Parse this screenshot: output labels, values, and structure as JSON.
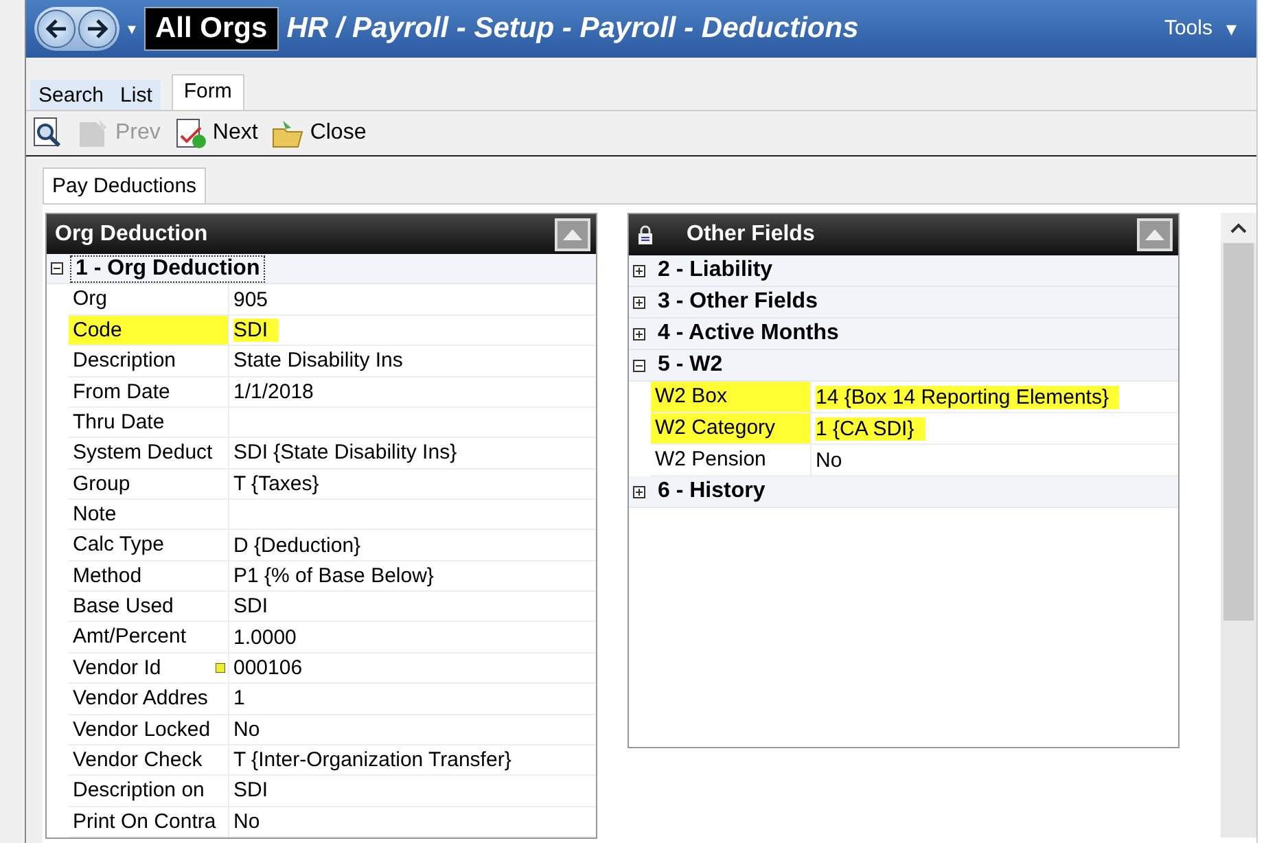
{
  "header": {
    "context": "All Orgs",
    "title": "HR / Payroll - Setup - Payroll - Deductions",
    "tools": "Tools",
    "dropdown": "▾"
  },
  "view_tabs": [
    {
      "label": "Search",
      "selected": false
    },
    {
      "label": "List",
      "selected": false
    },
    {
      "label": "Form",
      "selected": true
    }
  ],
  "toolbar": [
    {
      "kind": "find",
      "disabled": false
    },
    {
      "kind": "prev",
      "label": "Prev",
      "disabled": true
    },
    {
      "kind": "next",
      "label": "Next",
      "disabled": false
    },
    {
      "kind": "close",
      "label": "Close",
      "disabled": false
    }
  ],
  "form_tabs": [
    {
      "label": "Pay Deductions",
      "selected": true
    }
  ],
  "left_panel": {
    "title": "Org Deduction",
    "groups": [
      {
        "label": "1 - Org Deduction",
        "expanded": true,
        "fields": [
          {
            "label": "Org",
            "value": "905",
            "highlighted": false
          },
          {
            "label": "Code",
            "value": "SDI",
            "highlighted": true
          },
          {
            "label": "Description",
            "value": "State Disability Ins",
            "highlighted": false
          },
          {
            "label": "From Date",
            "value": "1/1/2018",
            "highlighted": false
          },
          {
            "label": "Thru Date",
            "highlighted": false
          },
          {
            "label": "System Deduct",
            "value": "SDI {State Disability Ins}",
            "highlighted": false
          },
          {
            "label": "Group",
            "value": "T {Taxes}",
            "highlighted": false
          },
          {
            "label": "Note",
            "highlighted": false
          },
          {
            "label": "Calc Type",
            "value": "D {Deduction}",
            "highlighted": false
          },
          {
            "label": "Method",
            "value": "P1 {% of Base Below}",
            "highlighted": false
          },
          {
            "label": "Base Used",
            "value": "SDI",
            "highlighted": false
          },
          {
            "label": "Amt/Percent",
            "value": "1.0000",
            "highlighted": false
          },
          {
            "label": "Vendor Id",
            "value": "000106",
            "highlighted": false,
            "lookup": true
          },
          {
            "label": "Vendor Addres",
            "value": "1",
            "highlighted": false
          },
          {
            "label": "Vendor Locked",
            "value": "No",
            "highlighted": false
          },
          {
            "label": "Vendor Check",
            "value": "T {Inter-Organization Transfer}",
            "highlighted": false
          },
          {
            "label": "Description on",
            "value": "SDI",
            "highlighted": false
          },
          {
            "label": "Print On Contra",
            "value": "No",
            "highlighted": false
          }
        ]
      }
    ]
  },
  "right_panel": {
    "title": "Other Fields",
    "groups": [
      {
        "label": "2 - Liability",
        "expanded": false
      },
      {
        "label": "3 - Other Fields",
        "expanded": false
      },
      {
        "label": "4 - Active Months",
        "expanded": false
      },
      {
        "label": "5 - W2",
        "expanded": true,
        "fields": [
          {
            "label": "W2 Box",
            "value": "14 {Box 14 Reporting Elements}",
            "highlighted": true
          },
          {
            "label": "W2 Category",
            "value": "1 {CA SDI}",
            "highlighted": true
          },
          {
            "label": "W2 Pension",
            "value": "No",
            "highlighted": false
          }
        ]
      },
      {
        "label": "6 - History",
        "expanded": false
      }
    ]
  }
}
